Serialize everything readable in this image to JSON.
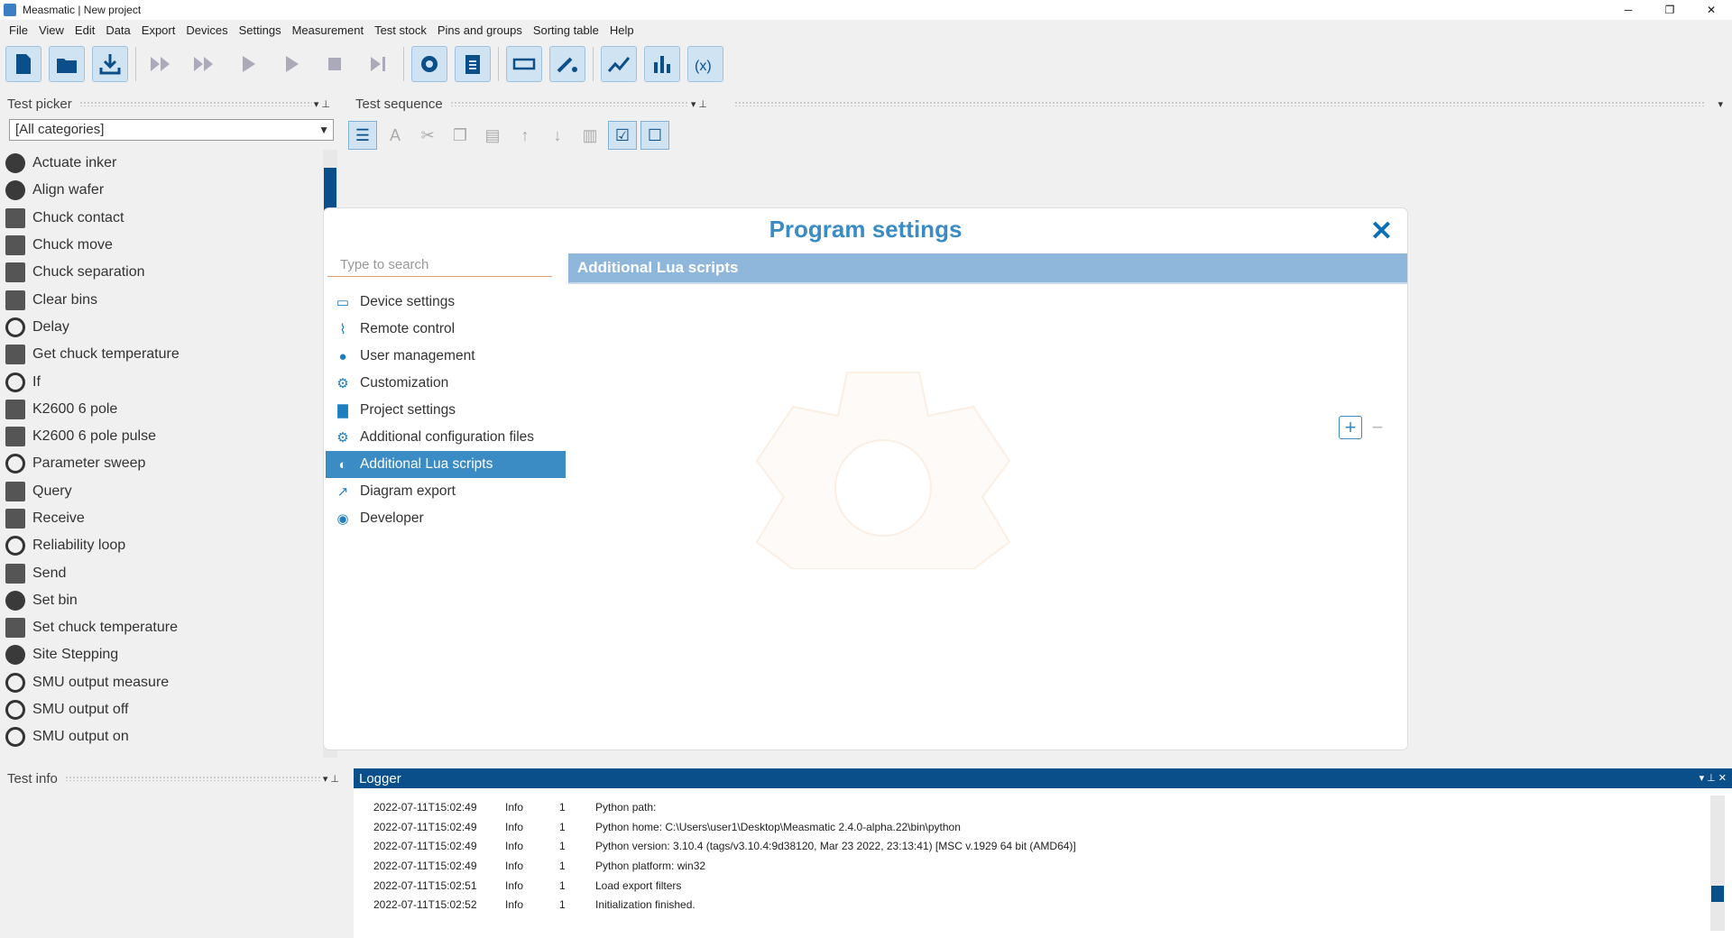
{
  "window": {
    "title": "Measmatic | New project",
    "controls": [
      "─",
      "❐",
      "✕"
    ]
  },
  "menu": [
    "File",
    "View",
    "Edit",
    "Data",
    "Export",
    "Devices",
    "Settings",
    "Measurement",
    "Test stock",
    "Pins and groups",
    "Sorting table",
    "Help"
  ],
  "toolbar_icons": [
    "new-file-icon",
    "open-folder-icon",
    "download-icon",
    "run-all-icon",
    "run-next-icon",
    "play-icon",
    "step-icon",
    "stop-icon",
    "skip-icon",
    "settings-icon",
    "clipboard-icon",
    "device-icon",
    "probe-icon",
    "line-chart-icon",
    "bar-chart-icon",
    "variable-icon"
  ],
  "test_picker": {
    "title": "Test picker",
    "category": "[All categories]",
    "items": [
      "Actuate inker",
      "Align wafer",
      "Chuck contact",
      "Chuck move",
      "Chuck separation",
      "Clear bins",
      "Delay",
      "Get chuck temperature",
      "If",
      "K2600 6 pole",
      "K2600 6 pole pulse",
      "Parameter sweep",
      "Query",
      "Receive",
      "Reliability loop",
      "Send",
      "Set bin",
      "Set chuck temperature",
      "Site Stepping",
      "SMU output measure",
      "SMU output off",
      "SMU output on"
    ]
  },
  "test_sequence": {
    "title": "Test sequence"
  },
  "test_info": {
    "title": "Test info"
  },
  "logger": {
    "title": "Logger",
    "rows": [
      {
        "time": "2022-07-11T15:02:49",
        "level": "Info",
        "num": "1",
        "msg": "Python path:"
      },
      {
        "time": "2022-07-11T15:02:49",
        "level": "Info",
        "num": "1",
        "msg": "Python home: C:\\Users\\user1\\Desktop\\Measmatic 2.4.0-alpha.22\\bin\\python"
      },
      {
        "time": "2022-07-11T15:02:49",
        "level": "Info",
        "num": "1",
        "msg": "Python version: 3.10.4 (tags/v3.10.4:9d38120, Mar 23 2022, 23:13:41) [MSC v.1929 64 bit (AMD64)]"
      },
      {
        "time": "2022-07-11T15:02:49",
        "level": "Info",
        "num": "1",
        "msg": "Python platform: win32"
      },
      {
        "time": "2022-07-11T15:02:51",
        "level": "Info",
        "num": "1",
        "msg": "Load export filters"
      },
      {
        "time": "2022-07-11T15:02:52",
        "level": "Info",
        "num": "1",
        "msg": "Initialization finished."
      }
    ]
  },
  "dialog": {
    "title": "Program settings",
    "search_placeholder": "Type to search",
    "active_section": "Additional Lua scripts",
    "nav": [
      {
        "label": "Device settings",
        "icon": "device-icon"
      },
      {
        "label": "Remote control",
        "icon": "remote-icon"
      },
      {
        "label": "User management",
        "icon": "user-icon"
      },
      {
        "label": "Customization",
        "icon": "gear-icon"
      },
      {
        "label": "Project settings",
        "icon": "document-icon"
      },
      {
        "label": "Additional configuration files",
        "icon": "gears-icon"
      },
      {
        "label": "Additional Lua scripts",
        "icon": "lua-icon"
      },
      {
        "label": "Diagram export",
        "icon": "chart-icon"
      },
      {
        "label": "Developer",
        "icon": "bug-icon"
      }
    ],
    "colors": {
      "accent": "#3b8bc4",
      "header": "#8fb7dc",
      "brand": "#0b4f8a"
    }
  }
}
